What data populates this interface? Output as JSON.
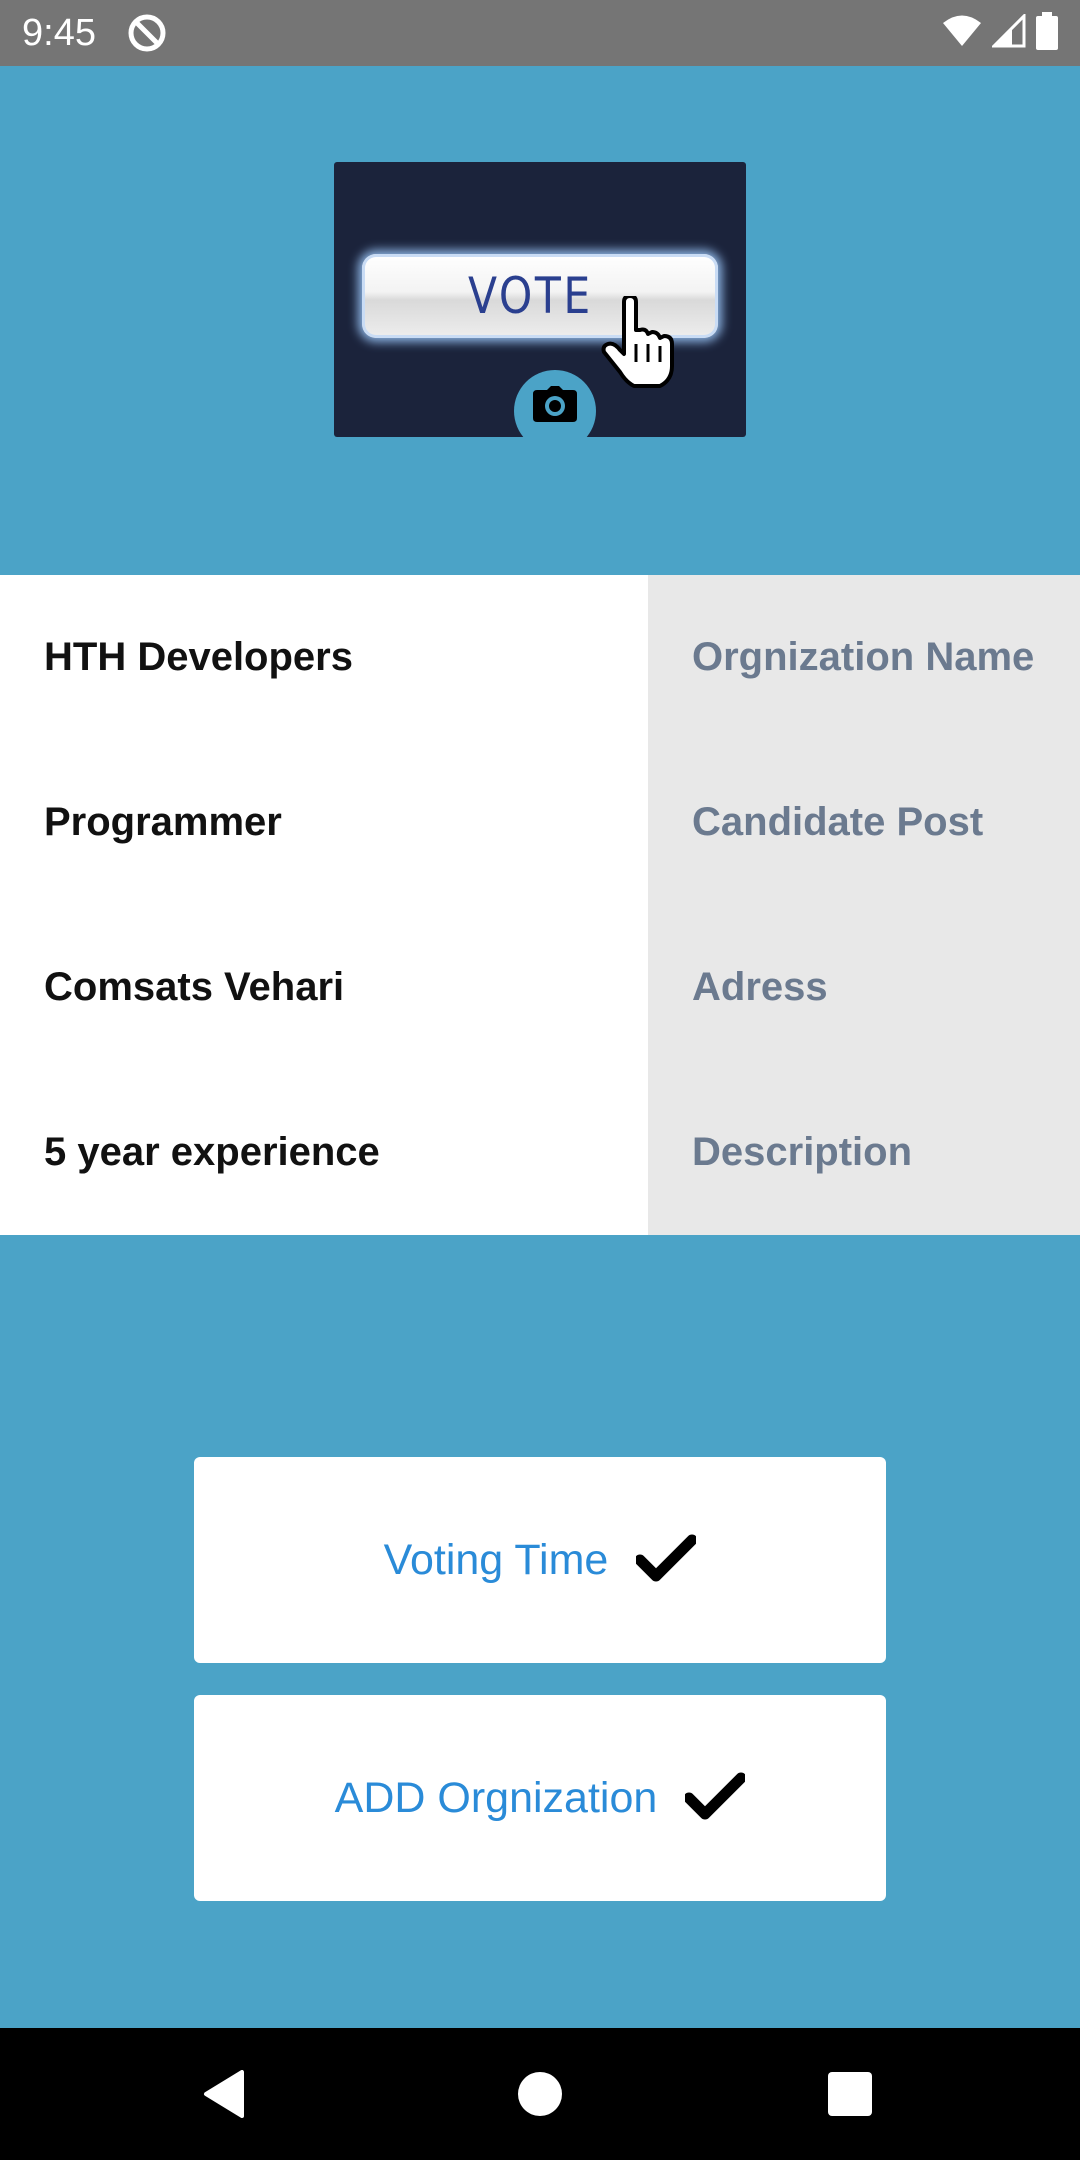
{
  "status_bar": {
    "time": "9:45",
    "app_icon": "data-saver-icon",
    "icons": [
      "wifi-icon",
      "signal-icon",
      "battery-icon"
    ]
  },
  "header": {
    "image_text": "VOTE",
    "image_icon": "hand-cursor-icon",
    "camera_icon": "camera-icon"
  },
  "info": {
    "rows": [
      {
        "value": "HTH Developers",
        "label": "Orgnization Name"
      },
      {
        "value": "Programmer",
        "label": "Candidate Post"
      },
      {
        "value": "Comsats Vehari",
        "label": "Adress"
      },
      {
        "value": "5 year experience",
        "label": "Description"
      }
    ]
  },
  "buttons": {
    "voting_time": "Voting Time",
    "add_organization": "ADD Orgnization",
    "check_icon": "check-icon"
  },
  "nav": {
    "icons": [
      "back-icon",
      "home-icon",
      "recents-icon"
    ]
  },
  "colors": {
    "background": "#4BA3C7",
    "status_bar": "#757575",
    "label_column": "#E8E8E8",
    "label_text": "#6B7A8F",
    "button_text": "#2A8BD8"
  }
}
